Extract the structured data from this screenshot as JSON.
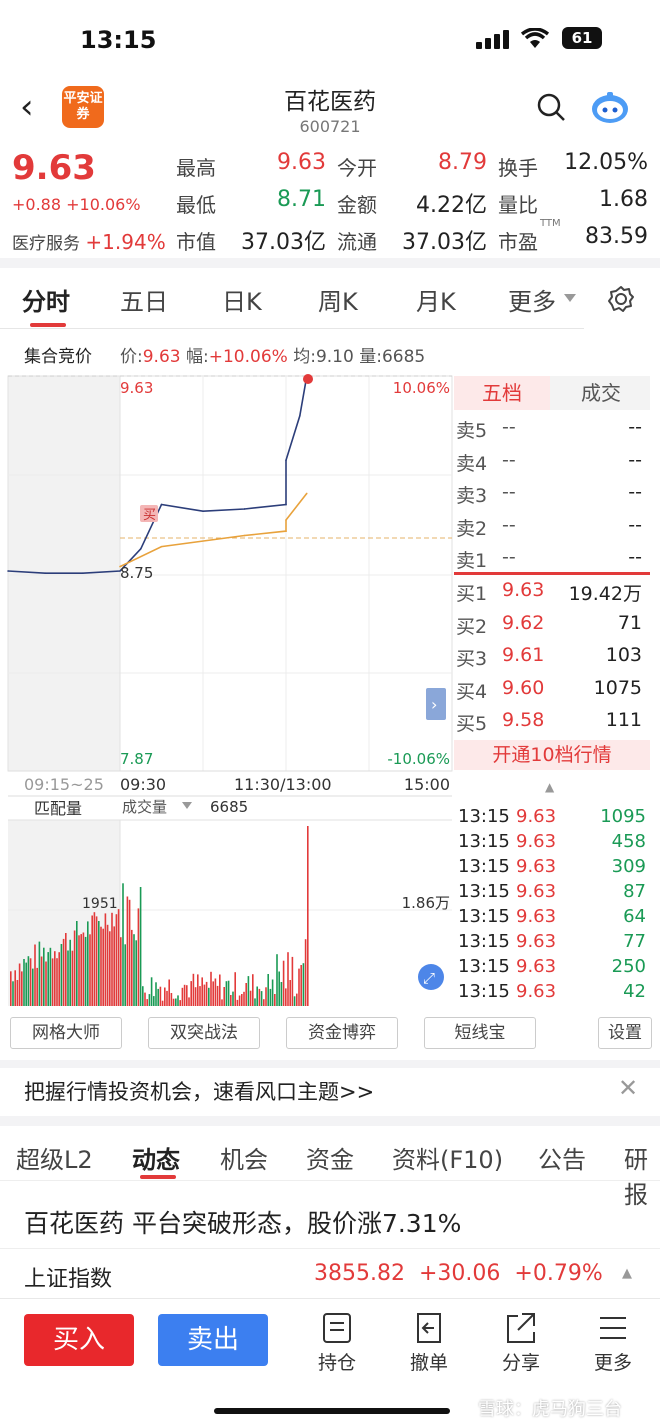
{
  "status": {
    "time": "13:15",
    "battery": "61"
  },
  "header": {
    "title": "百花医药",
    "code": "600721",
    "logo_text": "平安证券"
  },
  "quote": {
    "price": "9.63",
    "change": "+0.88",
    "change_pct": "+10.06%",
    "sector_name": "医疗服务",
    "sector_pct": "+1.94%",
    "fields": [
      {
        "label": "最高",
        "value": "9.63",
        "color": "red"
      },
      {
        "label": "今开",
        "value": "8.79",
        "color": "red"
      },
      {
        "label": "换手",
        "value": "12.05%",
        "color": "dark"
      },
      {
        "label": "最低",
        "value": "8.71",
        "color": "green"
      },
      {
        "label": "金额",
        "value": "4.22亿",
        "color": "dark"
      },
      {
        "label": "量比",
        "value": "1.68",
        "color": "dark"
      },
      {
        "label": "市值",
        "value": "37.03亿",
        "color": "dark"
      },
      {
        "label": "流通",
        "value": "37.03亿",
        "color": "dark"
      },
      {
        "label": "市盈",
        "value": "83.59",
        "color": "dark",
        "sup": "TTM"
      }
    ]
  },
  "chart_tabs": [
    "分时",
    "五日",
    "日K",
    "周K",
    "月K",
    "更多"
  ],
  "auction": {
    "label": "集合竞价",
    "price_lbl": "价:",
    "price": "9.63",
    "amp_lbl": "幅:",
    "amp": "+10.06%",
    "avg_lbl": "均:",
    "avg": "9.10",
    "vol_lbl": "量:",
    "vol": "6685"
  },
  "chart_labels": {
    "top_price": "9.63",
    "top_pct": "10.06%",
    "bottom_price": "7.87",
    "bottom_pct": "-10.06%",
    "mid_price": "8.75",
    "buy_mark": "买",
    "time_auction": "09:15~25",
    "t1": "09:30",
    "t2": "11:30/13:00",
    "t3": "15:00",
    "vol_left": "匹配量",
    "vol_sel": "成交量",
    "vol_val": "6685",
    "vol_mark": "1951",
    "vol_max": "1.86万"
  },
  "chart_data": {
    "type": "line",
    "title": "",
    "y_range": [
      7.87,
      9.63
    ],
    "series": [
      {
        "name": "",
        "x": [
          "09:15",
          "09:20",
          "09:25",
          "09:30",
          "09:45",
          "10:00",
          "10:30",
          "11:00",
          "11:30",
          "13:00",
          "13:10",
          "13:15"
        ],
        "values": [
          8.75,
          8.74,
          8.74,
          8.75,
          8.85,
          9.05,
          9.02,
          9.03,
          9.05,
          9.25,
          9.45,
          9.63
        ]
      },
      {
        "name": "",
        "x": [
          "09:30",
          "10:00",
          "11:00",
          "11:30",
          "13:00",
          "13:15"
        ],
        "values": [
          8.77,
          8.86,
          8.91,
          8.93,
          8.98,
          9.1
        ]
      }
    ]
  },
  "orderbook": {
    "tabs": [
      "五档",
      "成交"
    ],
    "asks": [
      {
        "name": "卖5",
        "price": "--",
        "vol": "--"
      },
      {
        "name": "卖4",
        "price": "--",
        "vol": "--"
      },
      {
        "name": "卖3",
        "price": "--",
        "vol": "--"
      },
      {
        "name": "卖2",
        "price": "--",
        "vol": "--"
      },
      {
        "name": "卖1",
        "price": "--",
        "vol": "--"
      }
    ],
    "bids": [
      {
        "name": "买1",
        "price": "9.63",
        "vol": "19.42万"
      },
      {
        "name": "买2",
        "price": "9.62",
        "vol": "71"
      },
      {
        "name": "买3",
        "price": "9.61",
        "vol": "103"
      },
      {
        "name": "买4",
        "price": "9.60",
        "vol": "1075"
      },
      {
        "name": "买5",
        "price": "9.58",
        "vol": "111"
      }
    ],
    "open_l2": "开通10档行情",
    "trades": [
      {
        "t": "13:15",
        "p": "9.63",
        "v": "1095"
      },
      {
        "t": "13:15",
        "p": "9.63",
        "v": "458"
      },
      {
        "t": "13:15",
        "p": "9.63",
        "v": "309"
      },
      {
        "t": "13:15",
        "p": "9.63",
        "v": "87"
      },
      {
        "t": "13:15",
        "p": "9.63",
        "v": "64"
      },
      {
        "t": "13:15",
        "p": "9.63",
        "v": "77"
      },
      {
        "t": "13:15",
        "p": "9.63",
        "v": "250"
      },
      {
        "t": "13:15",
        "p": "9.63",
        "v": "42"
      }
    ]
  },
  "func_buttons": [
    "网格大师",
    "双突战法",
    "资金博弈",
    "短线宝",
    "设置"
  ],
  "banner": "把握行情投资机会，速看风口主题>>",
  "bottom_tabs": [
    "超级L2",
    "动态",
    "机会",
    "资金",
    "资料(F10)",
    "公告",
    "研报"
  ],
  "news": "百花医药 平台突破形态，股价涨7.31%",
  "index": {
    "name": "上证指数",
    "value": "3855.82",
    "change": "+30.06",
    "pct": "+0.79%"
  },
  "actions": {
    "buy": "买入",
    "sell": "卖出",
    "tools": [
      "持仓",
      "撤单",
      "分享",
      "更多"
    ]
  },
  "watermark": "雪球：虎马狗三台"
}
